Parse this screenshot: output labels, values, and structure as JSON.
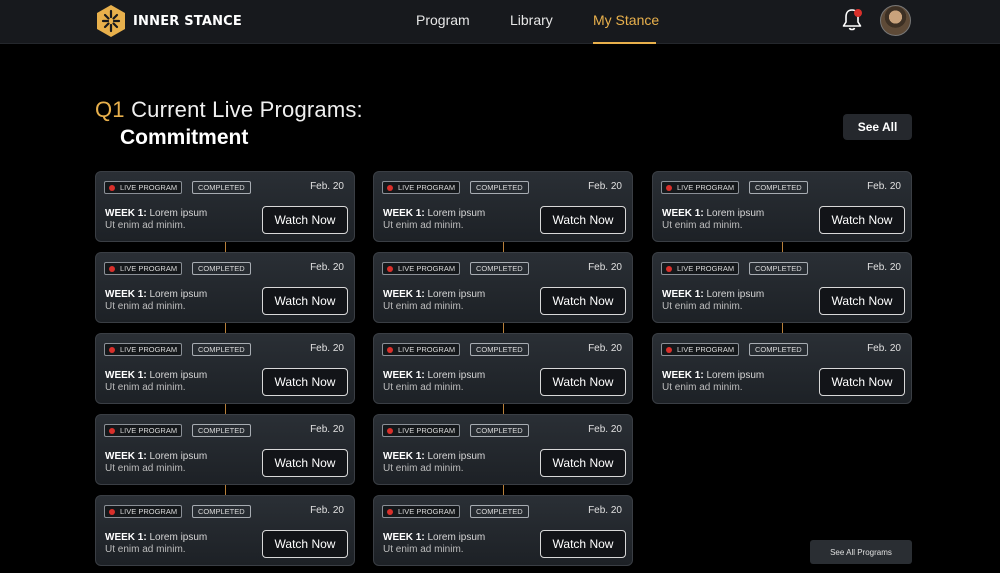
{
  "brand": {
    "name": "INNER STANCE",
    "logo_icon": "hexagon-logo-icon",
    "accent": "#e8b04c"
  },
  "nav": {
    "items": [
      {
        "label": "Program",
        "active": false
      },
      {
        "label": "Library",
        "active": false
      },
      {
        "label": "My Stance",
        "active": true
      }
    ],
    "notification_icon": "bell-icon",
    "avatar": "user-avatar"
  },
  "section": {
    "prefix": "Q1",
    "title": "Current Live Programs:",
    "subtitle": "Commitment",
    "see_all": "See All"
  },
  "card_template": {
    "live_label": "LIVE PROGRAM",
    "status_label": "COMPLETED",
    "date": "Feb. 20",
    "week_label": "WEEK 1:",
    "week_text": "Lorem ipsum",
    "description": "Ut enim ad minim.",
    "cta": "Watch Now"
  },
  "columns": [
    {
      "cards": 5
    },
    {
      "cards": 5
    },
    {
      "cards": 3
    }
  ],
  "footer": {
    "see_all_programs": "See All Programs"
  },
  "colors": {
    "live_dot": "#d9302b",
    "connector": "#b8803a",
    "notification_dot": "#d9302b"
  }
}
